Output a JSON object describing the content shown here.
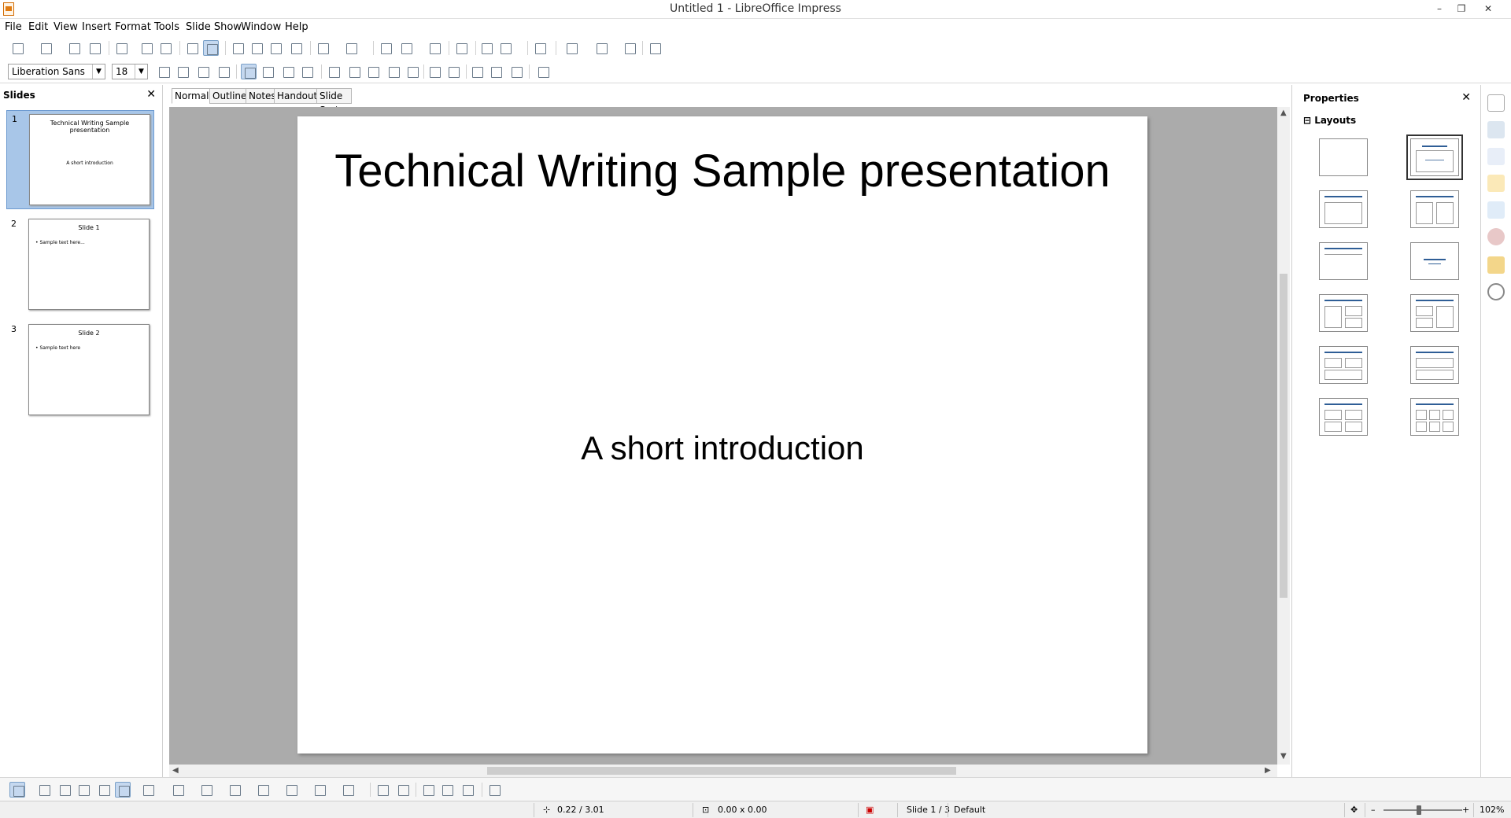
{
  "window": {
    "title": "Untitled 1 - LibreOffice Impress",
    "minimize": "–",
    "restore": "❐",
    "close": "✕"
  },
  "menu": [
    "File",
    "Edit",
    "View",
    "Insert",
    "Format",
    "Tools",
    "Slide Show",
    "Window",
    "Help"
  ],
  "formatting": {
    "font_name": "Liberation Sans",
    "font_size": "18"
  },
  "slides_panel": {
    "title": "Slides",
    "close": "✕",
    "slides": [
      {
        "number": "1",
        "title": "Technical Writing Sample presentation",
        "subtitle": "A short introduction"
      },
      {
        "number": "2",
        "title": "Slide 1",
        "bullet": "• Sample text here..."
      },
      {
        "number": "3",
        "title": "Slide 2",
        "bullet": "• Sample text here"
      }
    ]
  },
  "view_tabs": [
    "Normal",
    "Outline",
    "Notes",
    "Handout",
    "Slide Sorter"
  ],
  "current_slide": {
    "title": "Technical Writing Sample presentation",
    "subtitle": "A short introduction"
  },
  "properties_panel": {
    "title": "Properties",
    "close": "✕",
    "section": "Layouts",
    "section_toggle": "⊟"
  },
  "status": {
    "position": "0.22 / 3.01",
    "size": "0.00 x 0.00",
    "slide": "Slide 1 / 3",
    "master": "Default",
    "zoom": "102%",
    "zoom_minus": "–",
    "zoom_plus": "+"
  },
  "colors": {
    "accent": "#2f5e96",
    "selection": "#a8c6e8",
    "workspace": "#ababab"
  }
}
